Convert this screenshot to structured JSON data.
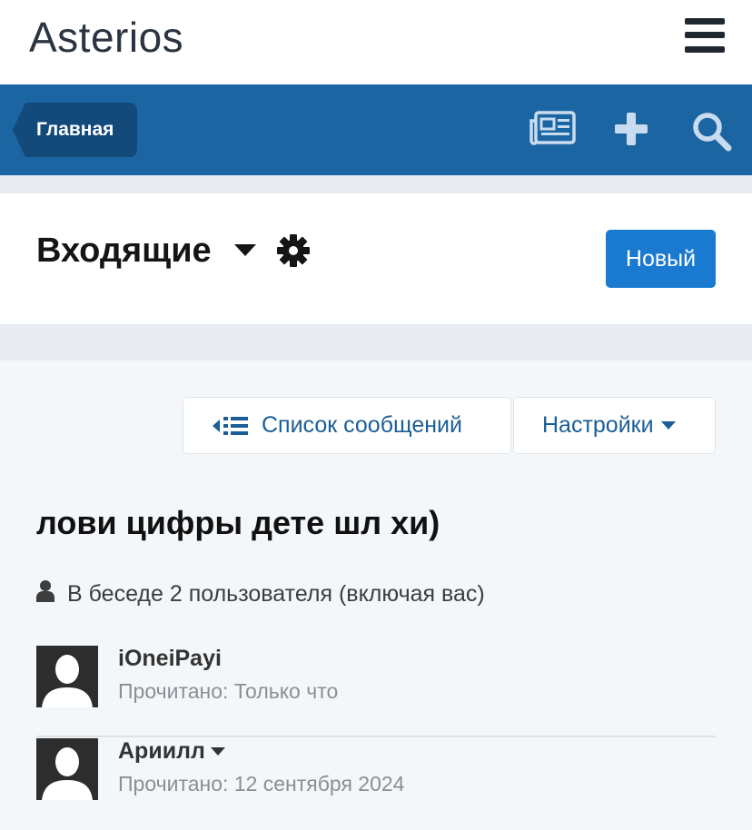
{
  "header": {
    "logo": "Asterios",
    "menu_icon": "hamburger-menu-icon"
  },
  "navbar": {
    "breadcrumb": "Главная",
    "icons": [
      "news-feed-icon",
      "plus-icon",
      "search-icon"
    ],
    "background": "#1b65a3"
  },
  "title_panel": {
    "title": "Входящие",
    "new_button": "Новый",
    "accent": "#1a7ad0"
  },
  "toolbar": {
    "list_button": "Список сообщений",
    "settings_button": "Настройки"
  },
  "conversation": {
    "title": "лови цифры дете шл  хи)",
    "participants_text": "В беседе 2 пользователя (включая вас)",
    "users": [
      {
        "name": "iOneiPayi",
        "read": "Прочитано: Только что"
      },
      {
        "name": "Ариилл",
        "read": "Прочитано: 12 сентября 2024"
      }
    ]
  }
}
